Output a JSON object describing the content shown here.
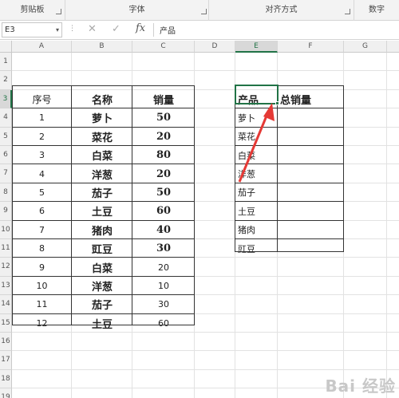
{
  "ribbon": {
    "groups": [
      "剪贴板",
      "字体",
      "对齐方式",
      "数字"
    ]
  },
  "formula_bar": {
    "name_box": "E3",
    "formula": "产品"
  },
  "columns": [
    "A",
    "B",
    "C",
    "D",
    "E",
    "F",
    "G"
  ],
  "rows": [
    "1",
    "2",
    "3",
    "4",
    "5",
    "6",
    "7",
    "8",
    "9",
    "10",
    "11",
    "12",
    "13",
    "14",
    "15",
    "16",
    "17",
    "18",
    "19"
  ],
  "table1": {
    "headers": [
      "序号",
      "名称",
      "销量"
    ],
    "rows": [
      [
        "1",
        "萝卜",
        "50"
      ],
      [
        "2",
        "菜花",
        "20"
      ],
      [
        "3",
        "白菜",
        "80"
      ],
      [
        "4",
        "洋葱",
        "20"
      ],
      [
        "5",
        "茄子",
        "50"
      ],
      [
        "6",
        "土豆",
        "60"
      ],
      [
        "7",
        "猪肉",
        "40"
      ],
      [
        "8",
        "豇豆",
        "30"
      ],
      [
        "9",
        "白菜",
        "20"
      ],
      [
        "10",
        "洋葱",
        "10"
      ],
      [
        "11",
        "茄子",
        "30"
      ],
      [
        "12",
        "土豆",
        "60"
      ]
    ]
  },
  "table2": {
    "headers": [
      "产品",
      "总销量"
    ],
    "products": [
      "萝卜",
      "菜花",
      "白菜",
      "洋葱",
      "茄子",
      "土豆",
      "猪肉",
      "豇豆"
    ]
  },
  "watermark": "Bai 经验",
  "annotation": {
    "arrow_color": "#e53935"
  }
}
